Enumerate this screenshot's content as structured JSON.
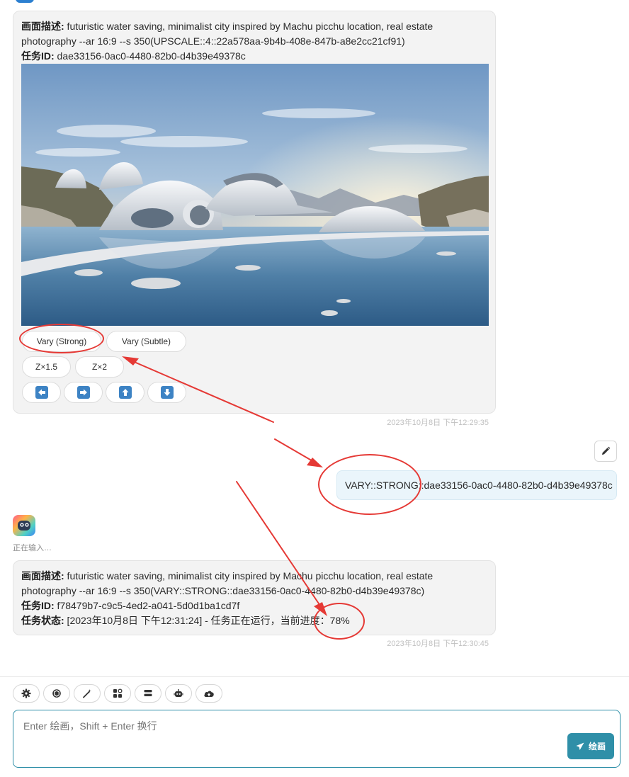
{
  "colors": {
    "accent": "#2f8fa8",
    "annotation": "#e53935",
    "bubble_bg": "#f3f3f3",
    "user_bubble_bg": "#eaf5fb",
    "direction_button": "#3d83c4"
  },
  "message1": {
    "prompt_label": "画面描述:",
    "prompt_text": " futuristic water saving, minimalist city inspired by Machu picchu location, real estate photography --ar 16:9 --s 350(UPSCALE::4::22a578aa-9b4b-408e-847b-a8e2cc21cf91)",
    "task_label": "任务ID:",
    "task_id": " dae33156-0ac0-4480-82b0-d4b39e49378c",
    "buttons": {
      "vary_strong": "Vary (Strong)",
      "vary_subtle": "Vary (Subtle)",
      "zoom_1_5": "Z×1.5",
      "zoom_2": "Z×2"
    },
    "direction_icons": [
      "arrow-left-icon",
      "arrow-right-icon",
      "arrow-up-icon",
      "arrow-down-icon"
    ],
    "timestamp": "2023年10月8日 下午12:29:35"
  },
  "user_message": {
    "text": "VARY::STRONG::dae33156-0ac0-4480-82b0-d4b39e49378c"
  },
  "bot": {
    "typing": "正在输入…"
  },
  "message2": {
    "prompt_label": "画面描述:",
    "prompt_text": " futuristic water saving, minimalist city inspired by Machu picchu location, real estate photography --ar 16:9 --s 350(VARY::STRONG::dae33156-0ac0-4480-82b0-d4b39e49378c)",
    "task_label": "任务ID:",
    "task_id": " f78479b7-c9c5-4ed2-a041-5d0d1ba1cd7f",
    "status_label": "任务状态:",
    "status_text": " [2023年10月8日 下午12:31:24] - 任务正在运行，当前进度：78%",
    "timestamp": "2023年10月8日 下午12:30:45"
  },
  "toolbar": {
    "icons": [
      "gear-icon",
      "openai-icon",
      "magic-wand-icon",
      "apps-icon",
      "layers-icon",
      "robot-icon",
      "cloud-upload-icon"
    ]
  },
  "composer": {
    "placeholder": "Enter 绘画，Shift + Enter 换行",
    "send_label": "绘画"
  }
}
